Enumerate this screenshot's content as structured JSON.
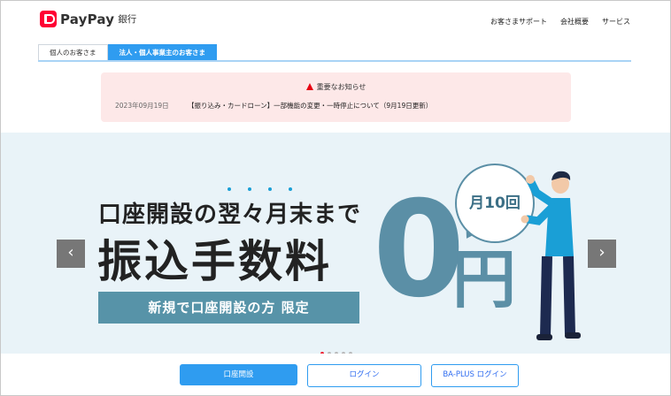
{
  "brand": {
    "name": "PayPay",
    "sub": "銀行"
  },
  "top_nav": [
    "お客さまサポート",
    "会社概要",
    "サービス"
  ],
  "tabs": [
    {
      "label": "個人のお客さま",
      "active": false
    },
    {
      "label": "法人・個人事業主のお客さま",
      "active": true
    }
  ],
  "notice": {
    "title": "重要なお知らせ",
    "date": "2023年09月19日",
    "text": "【振り込み・カードローン】一部機能の変更・一時停止について（9月19日更新）"
  },
  "hero": {
    "line1": "口座開設の翌々月末まで",
    "line2": "振込手数料",
    "band": "新規で口座開設の方 限定",
    "bubble": "月10回",
    "zero": "0",
    "yen": "円",
    "slide_count": 5,
    "current_slide": 1
  },
  "buttons": {
    "open_account": "口座開設",
    "login": "ログイン",
    "ba_plus_login": "BA-PLUS ログイン"
  },
  "colors": {
    "accent": "#2f9cf0",
    "brand": "#ff0033",
    "hero_bg": "#e9f3f8",
    "hero_text": "#5b8fa6"
  }
}
